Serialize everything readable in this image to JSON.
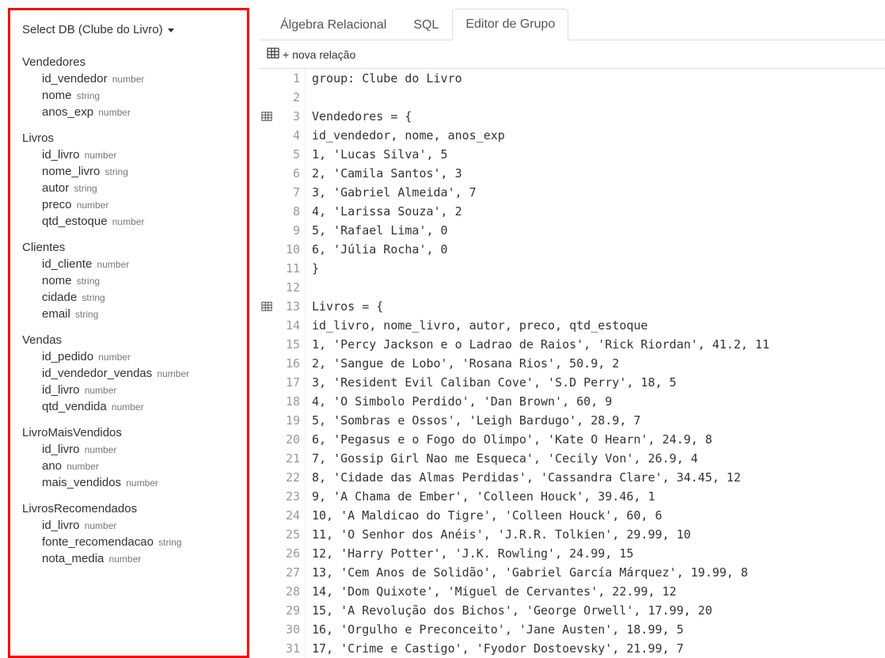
{
  "sidebar": {
    "selector_label": "Select DB (Clube do Livro)",
    "tables": [
      {
        "name": "Vendedores",
        "cols": [
          {
            "name": "id_vendedor",
            "type": "number"
          },
          {
            "name": "nome",
            "type": "string"
          },
          {
            "name": "anos_exp",
            "type": "number"
          }
        ]
      },
      {
        "name": "Livros",
        "cols": [
          {
            "name": "id_livro",
            "type": "number"
          },
          {
            "name": "nome_livro",
            "type": "string"
          },
          {
            "name": "autor",
            "type": "string"
          },
          {
            "name": "preco",
            "type": "number"
          },
          {
            "name": "qtd_estoque",
            "type": "number"
          }
        ]
      },
      {
        "name": "Clientes",
        "cols": [
          {
            "name": "id_cliente",
            "type": "number"
          },
          {
            "name": "nome",
            "type": "string"
          },
          {
            "name": "cidade",
            "type": "string"
          },
          {
            "name": "email",
            "type": "string"
          }
        ]
      },
      {
        "name": "Vendas",
        "cols": [
          {
            "name": "id_pedido",
            "type": "number"
          },
          {
            "name": "id_vendedor_vendas",
            "type": "number"
          },
          {
            "name": "id_livro",
            "type": "number"
          },
          {
            "name": "qtd_vendida",
            "type": "number"
          }
        ]
      },
      {
        "name": "LivroMaisVendidos",
        "cols": [
          {
            "name": "id_livro",
            "type": "number"
          },
          {
            "name": "ano",
            "type": "number"
          },
          {
            "name": "mais_vendidos",
            "type": "number"
          }
        ]
      },
      {
        "name": "LivrosRecomendados",
        "cols": [
          {
            "name": "id_livro",
            "type": "number"
          },
          {
            "name": "fonte_recomendacao",
            "type": "string"
          },
          {
            "name": "nota_media",
            "type": "number"
          }
        ]
      }
    ]
  },
  "tabs": {
    "items": [
      {
        "label": "Álgebra Relacional",
        "active": false
      },
      {
        "label": "SQL",
        "active": false
      },
      {
        "label": "Editor de Grupo",
        "active": true
      }
    ]
  },
  "toolbar": {
    "new_relation_label": "+ nova relação"
  },
  "editor": {
    "lines": [
      {
        "num": 1,
        "text": "group: Clube do Livro",
        "icon": null
      },
      {
        "num": 2,
        "text": "",
        "icon": null
      },
      {
        "num": 3,
        "text": "Vendedores = {",
        "icon": "table"
      },
      {
        "num": 4,
        "text": "id_vendedor, nome, anos_exp",
        "icon": null
      },
      {
        "num": 5,
        "text": "1, 'Lucas Silva', 5",
        "icon": null
      },
      {
        "num": 6,
        "text": "2, 'Camila Santos', 3",
        "icon": null
      },
      {
        "num": 7,
        "text": "3, 'Gabriel Almeida', 7",
        "icon": null
      },
      {
        "num": 8,
        "text": "4, 'Larissa Souza', 2",
        "icon": null
      },
      {
        "num": 9,
        "text": "5, 'Rafael Lima', 0",
        "icon": null
      },
      {
        "num": 10,
        "text": "6, 'Júlia Rocha', 0",
        "icon": null
      },
      {
        "num": 11,
        "text": "}",
        "icon": null
      },
      {
        "num": 12,
        "text": "",
        "icon": null
      },
      {
        "num": 13,
        "text": "Livros = {",
        "icon": "table"
      },
      {
        "num": 14,
        "text": "id_livro, nome_livro, autor, preco, qtd_estoque",
        "icon": null
      },
      {
        "num": 15,
        "text": "1, 'Percy Jackson e o Ladrao de Raios', 'Rick Riordan', 41.2, 11",
        "icon": null
      },
      {
        "num": 16,
        "text": "2, 'Sangue de Lobo', 'Rosana Rios', 50.9, 2",
        "icon": null
      },
      {
        "num": 17,
        "text": "3, 'Resident Evil Caliban Cove', 'S.D Perry', 18, 5",
        "icon": null
      },
      {
        "num": 18,
        "text": "4, 'O Simbolo Perdido', 'Dan Brown', 60, 9",
        "icon": null
      },
      {
        "num": 19,
        "text": "5, 'Sombras e Ossos', 'Leigh Bardugo', 28.9, 7",
        "icon": null
      },
      {
        "num": 20,
        "text": "6, 'Pegasus e o Fogo do Olimpo', 'Kate O Hearn', 24.9, 8",
        "icon": null
      },
      {
        "num": 21,
        "text": "7, 'Gossip Girl Nao me Esqueca', 'Cecily Von', 26.9, 4",
        "icon": null
      },
      {
        "num": 22,
        "text": "8, 'Cidade das Almas Perdidas', 'Cassandra Clare', 34.45, 12",
        "icon": null
      },
      {
        "num": 23,
        "text": "9, 'A Chama de Ember', 'Colleen Houck', 39.46, 1",
        "icon": null
      },
      {
        "num": 24,
        "text": "10, 'A Maldicao do Tigre', 'Colleen Houck', 60, 6",
        "icon": null
      },
      {
        "num": 25,
        "text": "11, 'O Senhor dos Anéis', 'J.R.R. Tolkien', 29.99, 10",
        "icon": null
      },
      {
        "num": 26,
        "text": "12, 'Harry Potter', 'J.K. Rowling', 24.99, 15",
        "icon": null
      },
      {
        "num": 27,
        "text": "13, 'Cem Anos de Solidão', 'Gabriel García Márquez', 19.99, 8",
        "icon": null
      },
      {
        "num": 28,
        "text": "14, 'Dom Quixote', 'Miguel de Cervantes', 22.99, 12",
        "icon": null
      },
      {
        "num": 29,
        "text": "15, 'A Revolução dos Bichos', 'George Orwell', 17.99, 20",
        "icon": null
      },
      {
        "num": 30,
        "text": "16, 'Orgulho e Preconceito', 'Jane Austen', 18.99, 5",
        "icon": null
      },
      {
        "num": 31,
        "text": "17, 'Crime e Castigo', 'Fyodor Dostoevsky', 21.99, 7",
        "icon": null
      }
    ]
  }
}
